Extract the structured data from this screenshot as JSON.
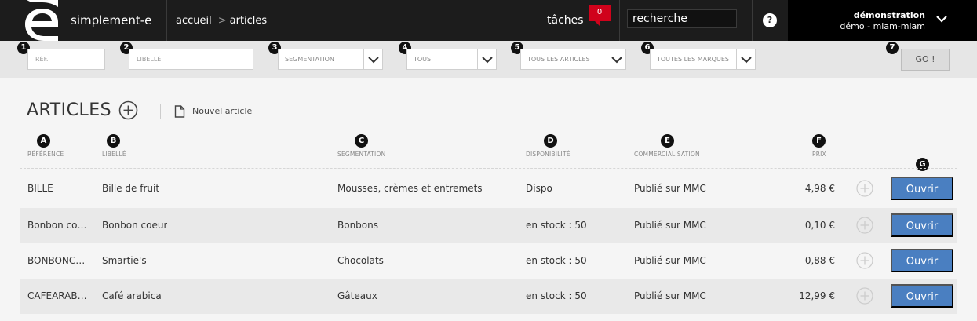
{
  "header": {
    "brand": "simplement-e",
    "breadcrumb_home": "accueil",
    "breadcrumb_separator": ">",
    "breadcrumb_current": "articles",
    "tasks_label": "tâches",
    "tasks_count": "0",
    "search_value": "recherche",
    "help_label": "?",
    "user_name": "démonstration",
    "user_sub": "démo - miam-miam"
  },
  "filters": {
    "ref": {
      "badge": "1",
      "placeholder": "RÉF."
    },
    "libelle": {
      "badge": "2",
      "placeholder": "LIBELLÉ"
    },
    "segmentation": {
      "badge": "3",
      "value": "SEGMENTATION"
    },
    "tous": {
      "badge": "4",
      "value": "TOUS"
    },
    "articles": {
      "badge": "5",
      "value": "TOUS LES ARTICLES"
    },
    "marques": {
      "badge": "6",
      "value": "TOUTES LES MARQUES"
    },
    "go": {
      "badge": "7",
      "label": "GO !"
    }
  },
  "main": {
    "title": "ARTICLES",
    "new_article": "Nouvel article"
  },
  "columns": [
    {
      "badge": "A",
      "label": "RÉFÉRENCE"
    },
    {
      "badge": "B",
      "label": "LIBELLÉ"
    },
    {
      "badge": "C",
      "label": "SEGMENTATION"
    },
    {
      "badge": "D",
      "label": "DISPONIBILITÉ"
    },
    {
      "badge": "E",
      "label": "COMMERCIALISATION"
    },
    {
      "badge": "F",
      "label": "PRIX"
    },
    {
      "badge": "G",
      "label": ""
    }
  ],
  "rows": [
    {
      "ref": "BILLE",
      "libelle": "Bille de fruit",
      "segmentation": "Mousses, crèmes et entremets",
      "disponibilite": "Dispo",
      "commercialisation": "Publié sur MMC",
      "prix": "4,98 €",
      "action": "Ouvrir"
    },
    {
      "ref": "Bonbon co…",
      "libelle": "Bonbon coeur",
      "segmentation": "Bonbons",
      "disponibilite": "en stock : 50",
      "commercialisation": "Publié sur MMC",
      "prix": "0,10 €",
      "action": "Ouvrir"
    },
    {
      "ref": "BONBONC…",
      "libelle": "Smartie's",
      "segmentation": "Chocolats",
      "disponibilite": "en stock : 50",
      "commercialisation": "Publié sur MMC",
      "prix": "0,88 €",
      "action": "Ouvrir"
    },
    {
      "ref": "CAFEARAB…",
      "libelle": "Café arabica",
      "segmentation": "Gâteaux",
      "disponibilite": "en stock : 50",
      "commercialisation": "Publié sur MMC",
      "prix": "12,99 €",
      "action": "Ouvrir"
    }
  ],
  "colors": {
    "topbar": "#1c1c1c",
    "accent_blue": "#4a7fc1",
    "badge_red": "#d0021b"
  }
}
